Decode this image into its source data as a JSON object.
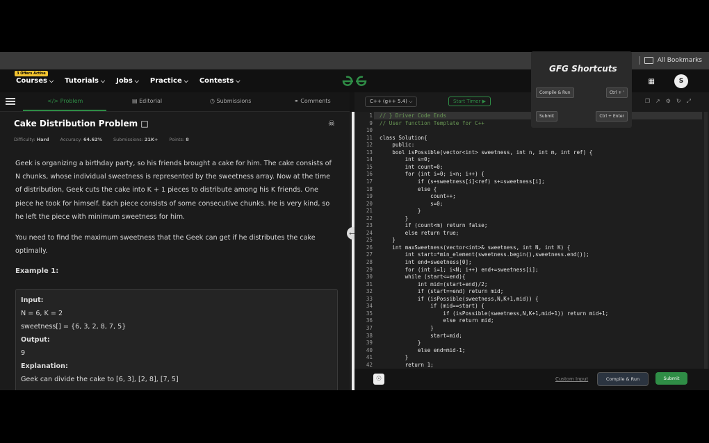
{
  "browser": {
    "bookmarks_label": "All Bookmarks"
  },
  "nav": {
    "offer_badge": "3 Offers Active",
    "items": [
      "Courses",
      "Tutorials",
      "Jobs",
      "Practice",
      "Contests"
    ],
    "avatar_letter": "S"
  },
  "tabs": [
    "</> Problem",
    "Editorial",
    "Submissions",
    "Comments"
  ],
  "problem": {
    "title": "Cake Distribution Problem",
    "difficulty_label": "Difficulty:",
    "difficulty": "Hard",
    "accuracy_label": "Accuracy:",
    "accuracy": "64.62%",
    "submissions_label": "Submissions:",
    "submissions": "21K+",
    "points_label": "Points:",
    "points": "8",
    "para1": "Geek is organizing a birthday party, so his friends brought a cake for him. The cake consists of N chunks, whose individual sweetness is represented by the sweetness array. Now at the time of distribution, Geek cuts the cake into K + 1 pieces to distribute among his K friends. One piece he took for himself. Each piece consists of some consecutive chunks. He is very kind, so he left the piece with minimum sweetness for him.",
    "para2": "You need to find the maximum sweetness that the Geek can get if he distributes the cake optimally.",
    "example_heading": "Example 1:",
    "example": {
      "input_label": "Input:",
      "input_line1": "N  = 6, K = 2",
      "input_line2": "sweetness[] = {6, 3, 2, 8, 7, 5}",
      "output_label": "Output:",
      "output": "9",
      "explanation_label": "Explanation:",
      "explanation": "Geek can divide the cake to [6, 3], [2, 8], [7, 5]"
    }
  },
  "editor": {
    "language": "C++ (g++ 5.4)",
    "timer_label": "Start Timer",
    "line_numbers": [
      "1",
      "9",
      "10",
      "11",
      "12",
      "13",
      "14",
      "15",
      "16",
      "17",
      "18",
      "19",
      "20",
      "21",
      "22",
      "23",
      "24",
      "25",
      "26",
      "27",
      "28",
      "29",
      "30",
      "31",
      "32",
      "33",
      "34",
      "35",
      "36",
      "37",
      "38",
      "39",
      "40",
      "41",
      "42"
    ],
    "lines": [
      "// } Driver Code Ends",
      "// User function Template for C++",
      "",
      "class Solution{",
      "    public:",
      "    bool isPossible(vector<int> sweetness, int n, int m, int ref) {",
      "        int s=0;",
      "        int count=0;",
      "        for (int i=0; i<n; i++) {",
      "            if (s+sweetness[i]<ref) s+=sweetness[i];",
      "            else {",
      "                count++;",
      "                s=0;",
      "            }",
      "        }",
      "        if (count<m) return false;",
      "        else return true;",
      "    }",
      "    int maxSweetness(vector<int>& sweetness, int N, int K) {",
      "        int start=*min_element(sweetness.begin(),sweetness.end());",
      "        int end=sweetness[0];",
      "        for (int i=1; i<N; i++) end+=sweetness[i];",
      "        while (start<=end){",
      "            int mid=(start+end)/2;",
      "            if (start==end) return mid;",
      "            if (isPossible(sweetness,N,K+1,mid)) {",
      "                if (mid==start) {",
      "                    if (isPossible(sweetness,N,K+1,mid+1)) return mid+1;",
      "                    else return mid;",
      "                }",
      "                start=mid;",
      "            }",
      "            else end=mid-1;",
      "        }",
      "        return 1;"
    ],
    "custom_input": "Custom Input",
    "compile_run": "Compile & Run",
    "submit": "Submit"
  },
  "shortcuts": {
    "title": "GFG Shortcuts",
    "compile_label": "Compile & Run",
    "compile_key": "Ctrl + '",
    "submit_label": "Submit",
    "submit_key": "Ctrl + Enter"
  },
  "colors": {
    "accent": "#2f8d46",
    "badge": "#f4c430"
  }
}
